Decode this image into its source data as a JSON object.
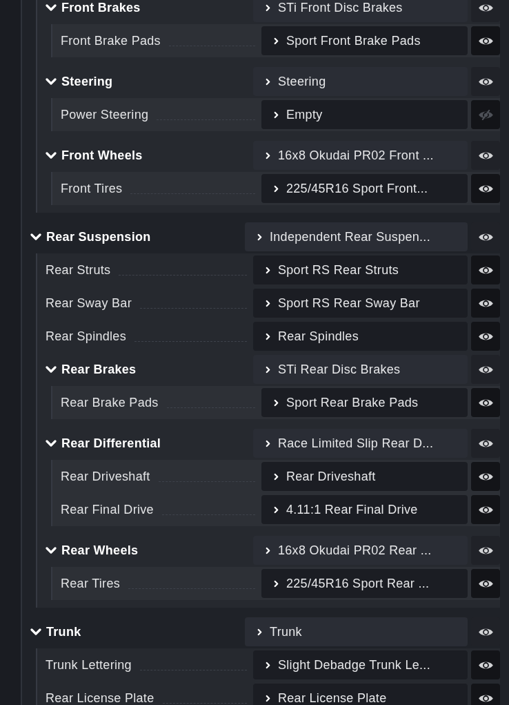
{
  "parts": [
    {
      "kind": "continued",
      "children": [
        {
          "kind": "group",
          "name": "Front Brakes",
          "part": "STi Front Disc Brakes",
          "visible": true,
          "expanded": true,
          "children": [
            {
              "kind": "leaf",
              "name": "Front Brake Pads",
              "part": "Sport Front Brake Pads",
              "visible": true
            }
          ]
        },
        {
          "kind": "group",
          "name": "Steering",
          "part": "Steering",
          "visible": true,
          "expanded": true,
          "children": [
            {
              "kind": "leaf",
              "name": "Power Steering",
              "part": "Empty",
              "visible": false
            }
          ]
        },
        {
          "kind": "group",
          "name": "Front Wheels",
          "part": "16x8 Okudai PR02 Front ...",
          "visible": true,
          "expanded": true,
          "children": [
            {
              "kind": "leaf",
              "name": "Front Tires",
              "part": "225/45R16 Sport Front...",
              "visible": true
            }
          ]
        }
      ]
    },
    {
      "kind": "group",
      "name": "Rear Suspension",
      "part": "Independent Rear Suspen...",
      "visible": true,
      "expanded": true,
      "children": [
        {
          "kind": "leaf",
          "name": "Rear Struts",
          "part": "Sport RS Rear Struts",
          "visible": true
        },
        {
          "kind": "leaf",
          "name": "Rear Sway Bar",
          "part": "Sport RS Rear Sway Bar",
          "visible": true
        },
        {
          "kind": "leaf",
          "name": "Rear Spindles",
          "part": "Rear Spindles",
          "visible": true
        },
        {
          "kind": "group",
          "name": "Rear Brakes",
          "part": "STi Rear Disc Brakes",
          "visible": true,
          "expanded": true,
          "children": [
            {
              "kind": "leaf",
              "name": "Rear Brake Pads",
              "part": "Sport Rear Brake Pads",
              "visible": true
            }
          ]
        },
        {
          "kind": "group",
          "name": "Rear Differential",
          "part": "Race Limited Slip Rear D...",
          "visible": true,
          "expanded": true,
          "children": [
            {
              "kind": "leaf",
              "name": "Rear Driveshaft",
              "part": "Rear Driveshaft",
              "visible": true
            },
            {
              "kind": "leaf",
              "name": "Rear Final Drive",
              "part": "4.11:1 Rear Final Drive",
              "visible": true
            }
          ]
        },
        {
          "kind": "group",
          "name": "Rear Wheels",
          "part": "16x8 Okudai PR02 Rear ...",
          "visible": true,
          "expanded": true,
          "children": [
            {
              "kind": "leaf",
              "name": "Rear Tires",
              "part": "225/45R16 Sport Rear ...",
              "visible": true
            }
          ]
        }
      ]
    },
    {
      "kind": "group",
      "name": "Trunk",
      "part": "Trunk",
      "visible": true,
      "expanded": true,
      "children": [
        {
          "kind": "leaf",
          "name": "Trunk Lettering",
          "part": "Slight Debadge Trunk Le...",
          "visible": true
        },
        {
          "kind": "leaf",
          "name": "Rear License Plate",
          "part": "Rear License Plate",
          "visible": true
        }
      ]
    }
  ]
}
